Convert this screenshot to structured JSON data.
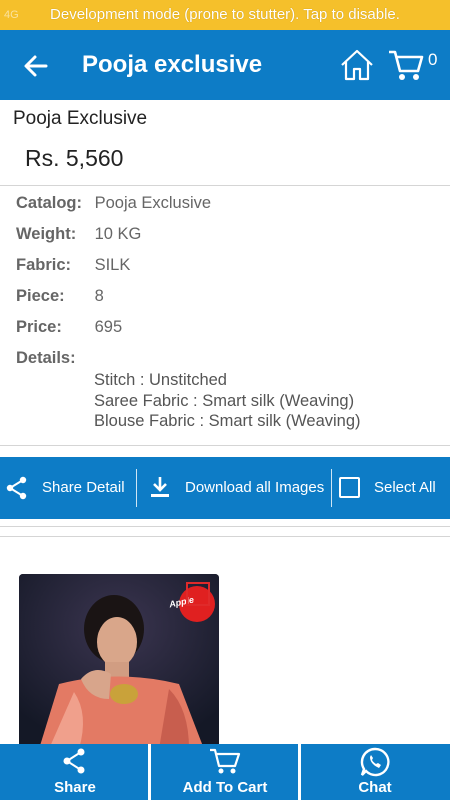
{
  "status_bar": {
    "signal": "4G",
    "message": "Development mode (prone to stutter). Tap to disable."
  },
  "app_bar": {
    "title": "Pooja exclusive",
    "cart_count": "0"
  },
  "product": {
    "name": "Pooja Exclusive",
    "price": "Rs. 5,560"
  },
  "specs": [
    {
      "label": "Catalog:",
      "value": "Pooja Exclusive"
    },
    {
      "label": "Weight:",
      "value": "10 KG"
    },
    {
      "label": "Fabric:",
      "value": "SILK"
    },
    {
      "label": "Piece:",
      "value": "8"
    },
    {
      "label": "Price:",
      "value": "695"
    }
  ],
  "details": {
    "label": "Details:",
    "lines": [
      "Stitch : Unstitched",
      "Saree Fabric : Smart silk (Weaving)",
      "Blouse Fabric : Smart silk (Weaving)"
    ]
  },
  "actions": {
    "share_detail": "Share Detail",
    "download_all": "Download all Images",
    "select_all": "Select All"
  },
  "thumbnail": {
    "badge": "Apple"
  },
  "bottom_bar": {
    "share": "Share",
    "add_to_cart": "Add To Cart",
    "chat": "Chat"
  },
  "colors": {
    "primary": "#0d7cc6",
    "status": "#f5c02b",
    "checkbox": "#e02a2a"
  }
}
